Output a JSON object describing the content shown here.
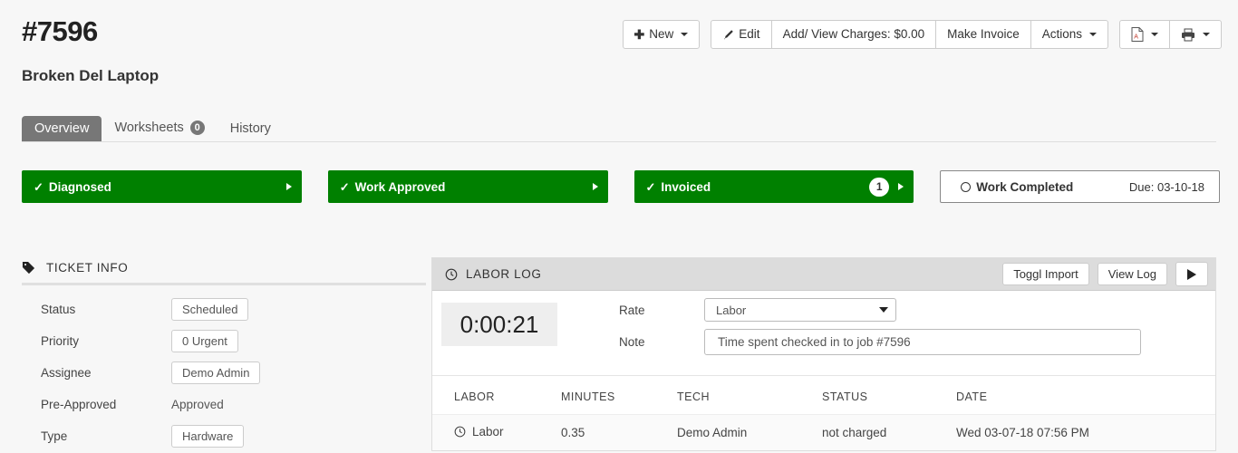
{
  "header": {
    "ticket_number": "#7596",
    "subject": "Broken Del Laptop"
  },
  "toolbar": {
    "new_label": "New",
    "edit_label": "Edit",
    "charges_label": "Add/ View Charges: $0.00",
    "make_invoice_label": "Make Invoice",
    "actions_label": "Actions",
    "pdf_icon": "pdf-file-icon",
    "print_icon": "printer-icon"
  },
  "tabs": [
    {
      "label": "Overview",
      "badge": null,
      "active": true
    },
    {
      "label": "Worksheets",
      "badge": "0",
      "active": false
    },
    {
      "label": "History",
      "badge": null,
      "active": false
    }
  ],
  "status_steps": [
    {
      "label": "Diagnosed",
      "state": "done",
      "count": null,
      "due": null
    },
    {
      "label": "Work Approved",
      "state": "done",
      "count": null,
      "due": null
    },
    {
      "label": "Invoiced",
      "state": "done",
      "count": "1",
      "due": null
    },
    {
      "label": "Work Completed",
      "state": "pending",
      "count": null,
      "due": "Due: 03-10-18"
    }
  ],
  "ticket_info": {
    "title": "TICKET INFO",
    "icon": "tag-icon",
    "rows": [
      {
        "label": "Status",
        "value": "Scheduled",
        "pill": true
      },
      {
        "label": "Priority",
        "value": "0 Urgent",
        "pill": true
      },
      {
        "label": "Assignee",
        "value": "Demo Admin",
        "pill": true
      },
      {
        "label": "Pre-Approved",
        "value": "Approved",
        "pill": false
      },
      {
        "label": "Type",
        "value": "Hardware",
        "pill": true
      }
    ]
  },
  "labor_log": {
    "title": "LABOR LOG",
    "icon": "clock-icon",
    "toggl_import_label": "Toggl Import",
    "view_log_label": "View Log",
    "play_icon": "play-icon",
    "timer": "0:00:21",
    "rate_label": "Rate",
    "rate_value": "Labor",
    "note_label": "Note",
    "note_value": "Time spent checked in to job #7596",
    "columns": [
      "LABOR",
      "MINUTES",
      "TECH",
      "STATUS",
      "DATE"
    ],
    "rows": [
      {
        "labor": "Labor",
        "minutes": "0.35",
        "tech": "Demo Admin",
        "status": "not charged",
        "date": "Wed 03-07-18 07:56 PM"
      }
    ]
  },
  "colors": {
    "status_done": "#008000",
    "tab_active": "#777777",
    "page_bg": "#f7f7f7",
    "panel_head_bg": "#dcdcdc"
  }
}
